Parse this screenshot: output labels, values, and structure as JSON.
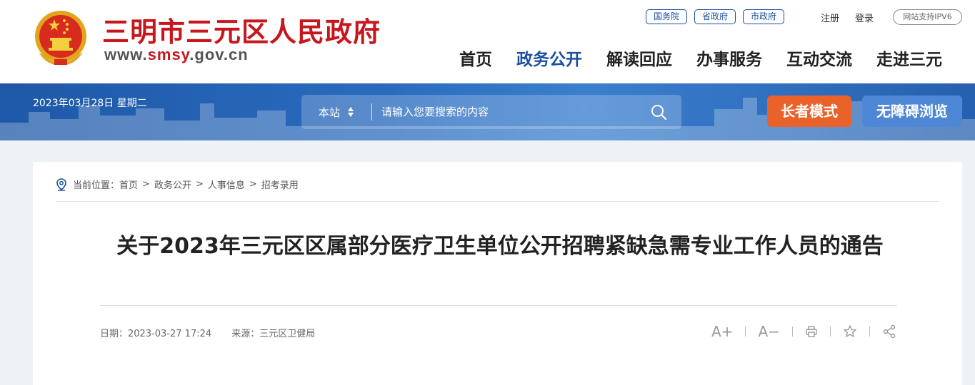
{
  "header": {
    "site_title": "三明市三元区人民政府",
    "site_url_prefix": "www.",
    "site_url_highlight": "smsy",
    "site_url_suffix": ".gov.cn",
    "gov_links": [
      "国务院",
      "省政府",
      "市政府"
    ],
    "register": "注册",
    "login": "登录",
    "ipv6": "网站支持IPV6",
    "nav": [
      "首页",
      "政务公开",
      "解读回应",
      "办事服务",
      "互动交流",
      "走进三元"
    ],
    "active_nav": "政务公开"
  },
  "banner": {
    "date": "2023年03月28日 星期二",
    "search_scope": "本站",
    "search_placeholder": "请输入您要搜索的内容",
    "elder_mode": "长者模式",
    "accessibility": "无障碍浏览"
  },
  "breadcrumb": {
    "label": "当前位置：",
    "items": [
      "首页",
      "政务公开",
      "人事信息",
      "招考录用"
    ]
  },
  "article": {
    "title": "关于2023年三元区区属部分医疗卫生单位公开招聘紧缺急需专业工作人员的通告",
    "date": "日期：2023-03-27 17:24",
    "source": "来源：三元区卫健局",
    "tools": {
      "font_increase": "A+",
      "font_decrease": "A−"
    }
  },
  "colors": {
    "brand_red": "#c8161d",
    "brand_blue": "#1b4fa0",
    "elder_orange": "#e8622a",
    "access_blue": "#4d87d6"
  }
}
